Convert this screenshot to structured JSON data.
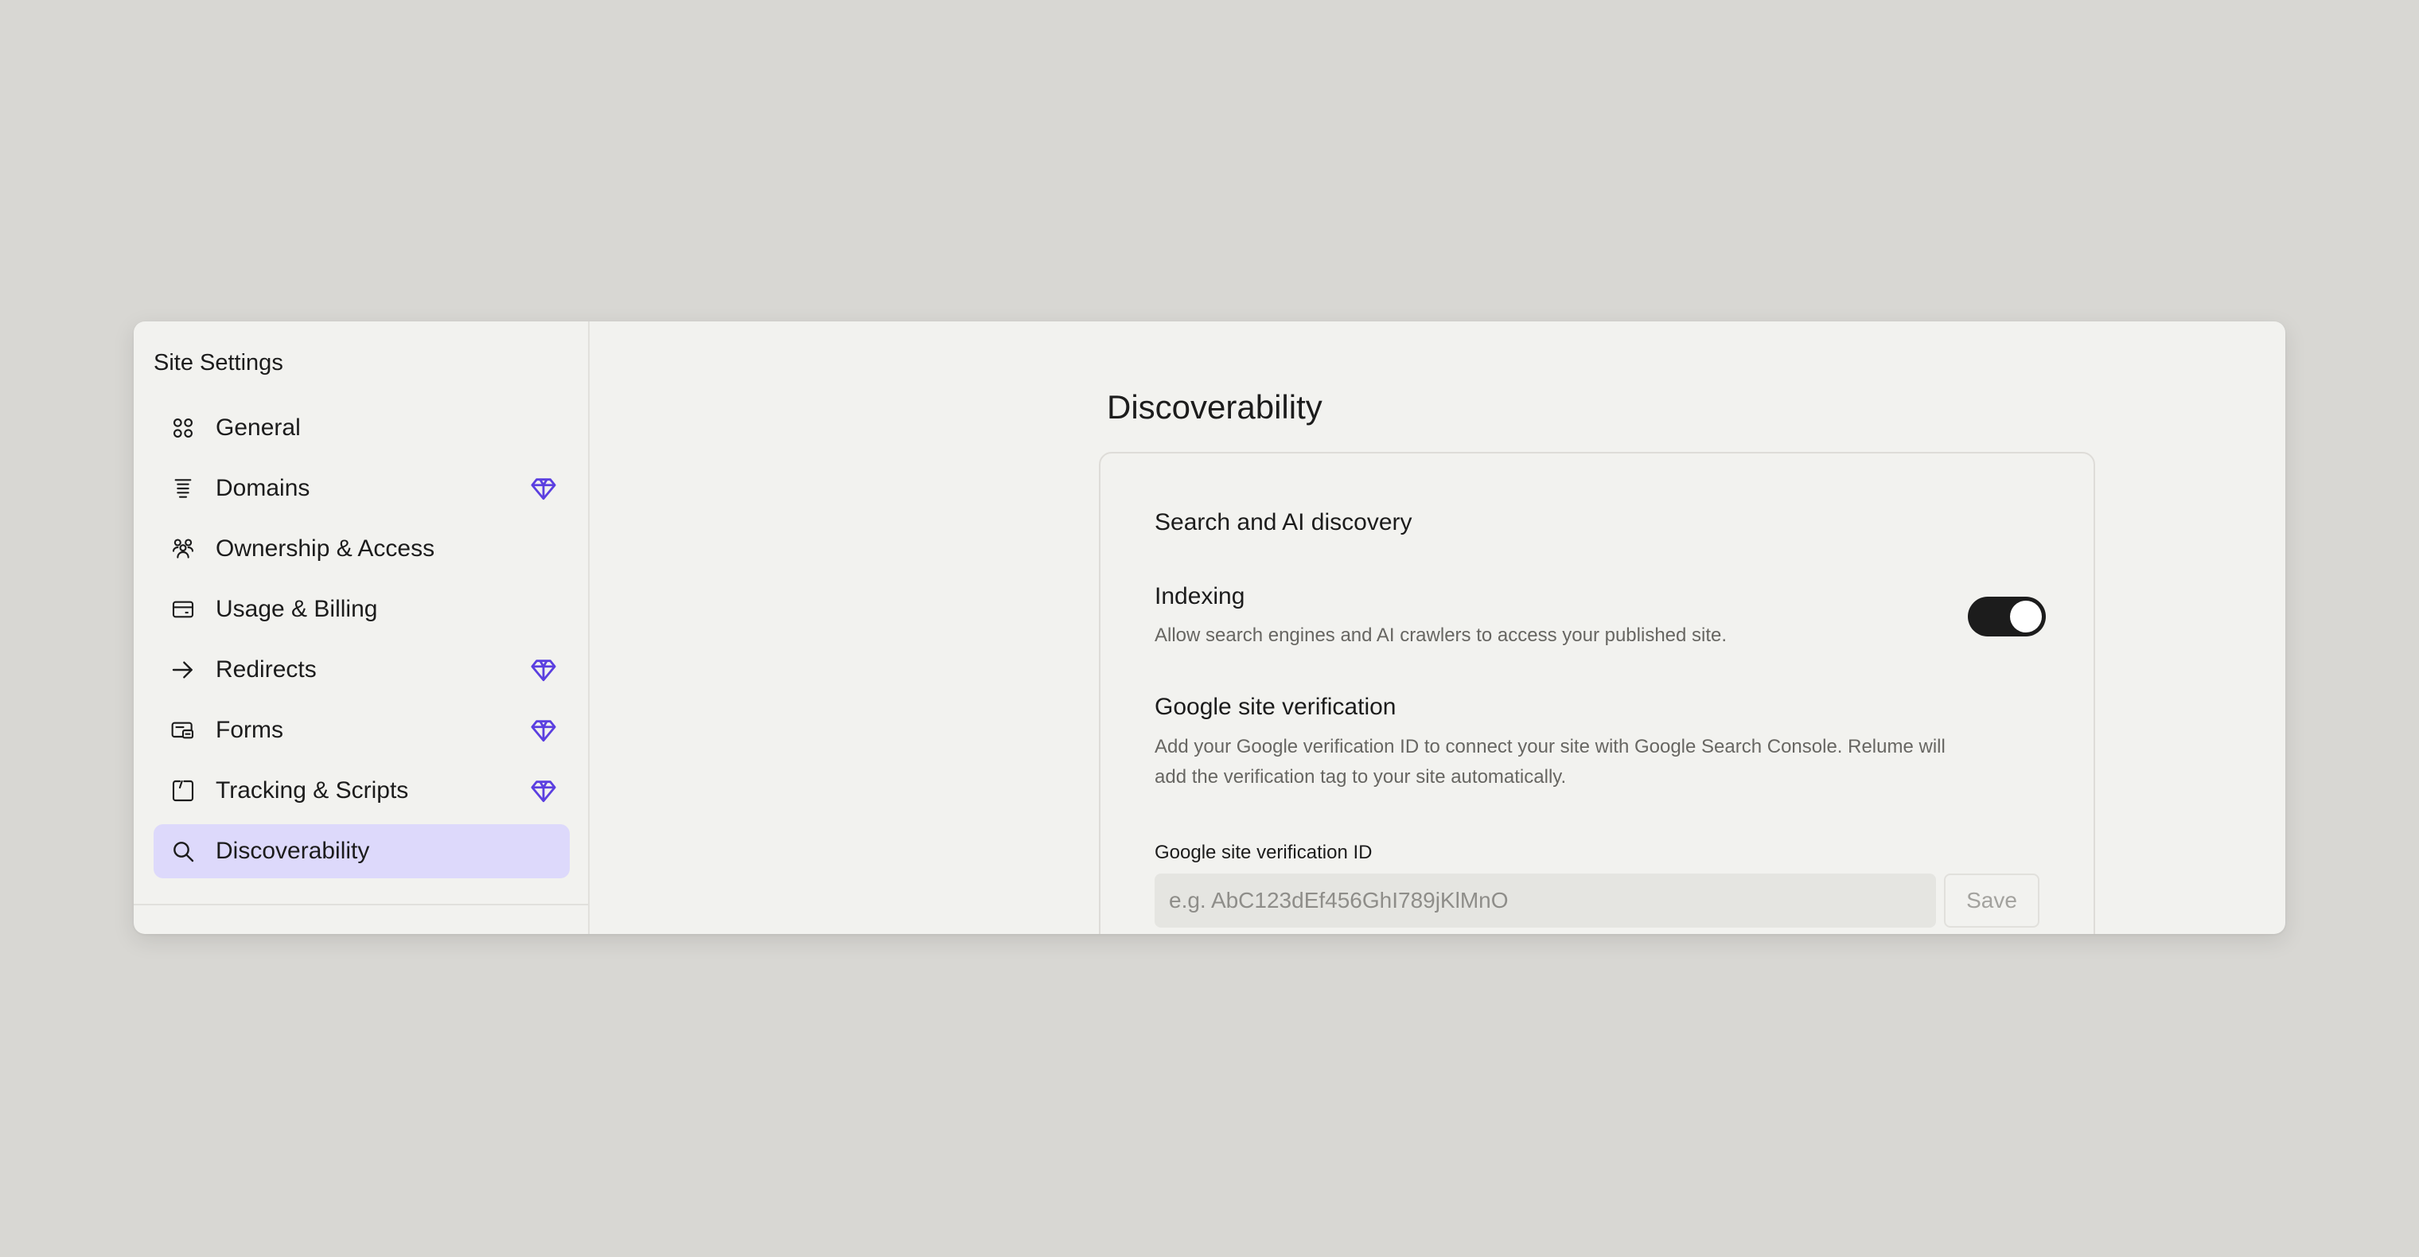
{
  "sidebar": {
    "title": "Site Settings",
    "items": [
      {
        "label": "General",
        "icon": "grid-icon",
        "premium": false
      },
      {
        "label": "Domains",
        "icon": "list-icon",
        "premium": true
      },
      {
        "label": "Ownership & Access",
        "icon": "users-icon",
        "premium": false
      },
      {
        "label": "Usage & Billing",
        "icon": "credit-card-icon",
        "premium": false
      },
      {
        "label": "Redirects",
        "icon": "arrow-right-icon",
        "premium": true
      },
      {
        "label": "Forms",
        "icon": "form-icon",
        "premium": true
      },
      {
        "label": "Tracking & Scripts",
        "icon": "script-icon",
        "premium": true
      },
      {
        "label": "Discoverability",
        "icon": "search-icon",
        "premium": false,
        "active": true
      }
    ]
  },
  "main": {
    "title": "Discoverability",
    "card": {
      "section_title": "Search and AI discovery",
      "indexing": {
        "title": "Indexing",
        "description": "Allow search engines and AI crawlers to access your published site.",
        "enabled": true
      },
      "verification": {
        "title": "Google site verification",
        "description_line1": "Add your Google verification ID to connect your site with Google Search Console. Relume will",
        "description_line2": "add the verification tag to your site automatically.",
        "field_label": "Google site verification ID",
        "placeholder": "e.g. AbC123dEf456GhI789jKlMnO",
        "value": "",
        "save_label": "Save"
      }
    }
  },
  "colors": {
    "background": "#d8d7d3",
    "panel": "#f2f2ef",
    "active_nav": "#ddd9fb",
    "premium_gem": "#5b3fe0",
    "toggle_on": "#1c1c1c"
  }
}
